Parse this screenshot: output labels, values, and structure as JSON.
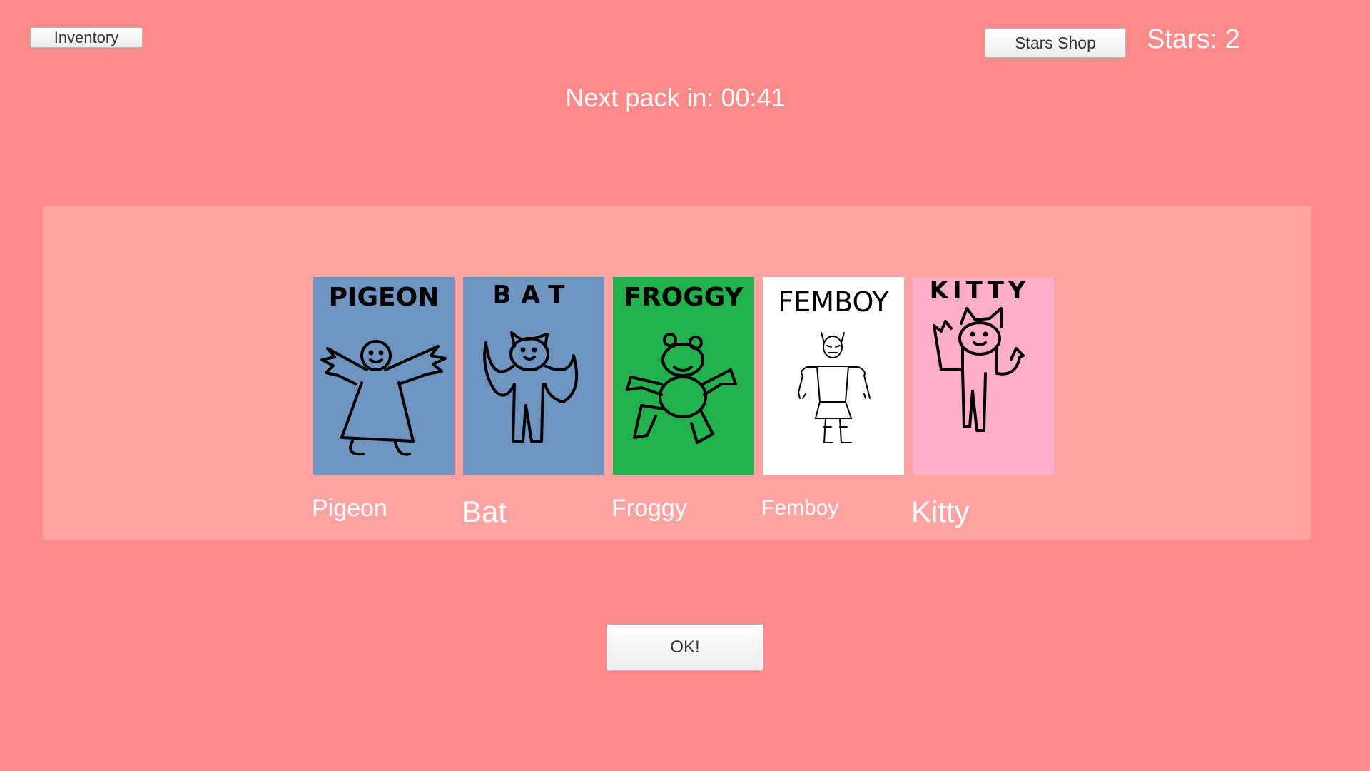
{
  "header": {
    "inventory_label": "Inventory",
    "shop_label": "Stars Shop",
    "stars_text": "Stars: 2"
  },
  "timer_text": "Next pack in: 00:41",
  "cards": [
    {
      "title": "PIGEON",
      "name": "Pigeon",
      "background": "#7094c0"
    },
    {
      "title": "BAT",
      "name": "Bat",
      "background": "#7094c0"
    },
    {
      "title": "FROGGY",
      "name": "Froggy",
      "background": "#22b14c"
    },
    {
      "title": "FEMBOY",
      "name": "Femboy",
      "background": "#ffffff"
    },
    {
      "title": "KITTY",
      "name": "Kitty",
      "background": "#ffaec9"
    }
  ],
  "ok_label": "OK!",
  "colors": {
    "page_background": "#ff8a8a",
    "panel_overlay": "#f69b9b",
    "text": "#ffffff"
  }
}
